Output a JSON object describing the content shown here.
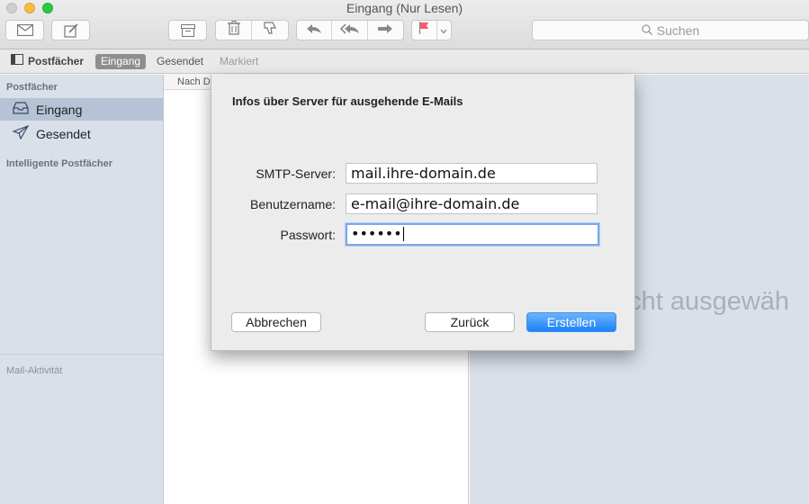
{
  "window": {
    "title": "Eingang (Nur Lesen)"
  },
  "toolbar": {
    "search_placeholder": "Suchen"
  },
  "favorites": {
    "mailboxes_label": "Postfächer",
    "inbox_label": "Eingang",
    "sent_label": "Gesendet",
    "flagged_label": "Markiert"
  },
  "sidebar": {
    "section_mailboxes": "Postfächer",
    "items": [
      {
        "label": "Eingang"
      },
      {
        "label": "Gesendet"
      }
    ],
    "section_smart": "Intelligente Postfächer",
    "section_activity": "Mail-Aktivität"
  },
  "message_list": {
    "sort_label": "Nach D"
  },
  "preview": {
    "empty_text": "richt ausgewäh"
  },
  "dialog": {
    "title": "Infos über Server für ausgehende E-Mails",
    "smtp_label": "SMTP-Server:",
    "smtp_value": "mail.ihre-domain.de",
    "user_label": "Benutzername:",
    "user_value": "e-mail@ihre-domain.de",
    "password_label": "Passwort:",
    "password_value": "••••••",
    "cancel_label": "Abbrechen",
    "back_label": "Zurück",
    "create_label": "Erstellen"
  },
  "colors": {
    "accent": "#1a82fb",
    "sidebar_bg": "#d9e0ea",
    "sidebar_selected": "#b6c3d6"
  }
}
